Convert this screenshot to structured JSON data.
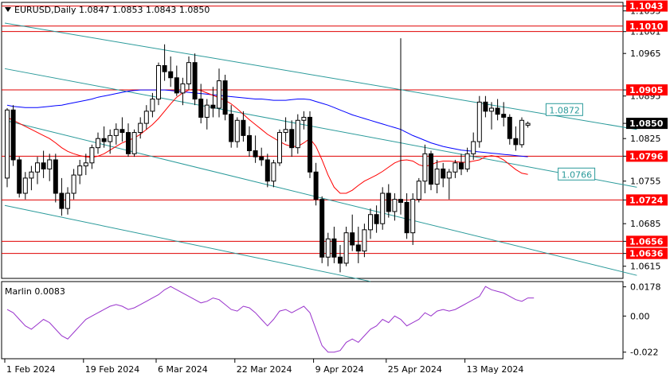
{
  "header": {
    "symbol_line": "EURUSD,Daily  1.0847 1.0853 1.0843 1.0850",
    "arrow_icon": "triangle-down-icon"
  },
  "chart_data": [
    {
      "type": "candlestick",
      "symbol": "EURUSD",
      "timeframe": "Daily",
      "ohlc": {
        "open": 1.0847,
        "high": 1.0853,
        "low": 1.0843,
        "close": 1.085
      },
      "ylim": [
        1.0595,
        1.1049
      ],
      "y_ticks": [
        "1.1043",
        "1.1035",
        "1.1001",
        "1.0965",
        "1.0905",
        "1.0895",
        "1.0850",
        "1.0825",
        "1.0796",
        "1.0755",
        "1.0724",
        "1.0685",
        "1.0656",
        "1.0636",
        "1.0615"
      ],
      "x_labels": [
        "1 Feb 2024",
        "19 Feb 2024",
        "6 Mar 2024",
        "22 Mar 2024",
        "9 Apr 2024",
        "25 Apr 2024",
        "13 May 2024"
      ],
      "price_labels": [
        {
          "text": "1.1043",
          "price": 1.1043,
          "color": "#ff0000"
        },
        {
          "text": "1.1010",
          "price": 1.101,
          "color": "#ff0000"
        },
        {
          "text": "1.0905",
          "price": 1.0905,
          "color": "#ff0000"
        },
        {
          "text": "1.0850",
          "price": 1.085,
          "color": "#000000"
        },
        {
          "text": "1.0796",
          "price": 1.0796,
          "color": "#ff0000"
        },
        {
          "text": "1.0724",
          "price": 1.0724,
          "color": "#ff0000"
        },
        {
          "text": "1.0656",
          "price": 1.0656,
          "color": "#ff0000"
        },
        {
          "text": "1.0636",
          "price": 1.0636,
          "color": "#ff0000"
        }
      ],
      "horizontal_levels": [
        1.1043,
        1.101,
        1.1001,
        1.0905,
        1.0796,
        1.0724,
        1.0656,
        1.0636
      ],
      "channel_labels": [
        {
          "text": "1.0872",
          "price": 1.0872
        },
        {
          "text": "1.0766",
          "price": 1.0766
        }
      ],
      "candles": [
        [
          1.076,
          1.0875,
          1.0745,
          1.0872
        ],
        [
          1.0872,
          1.088,
          1.078,
          1.079
        ],
        [
          1.079,
          1.0795,
          1.0728,
          1.0735
        ],
        [
          1.0735,
          1.077,
          1.0725,
          1.076
        ],
        [
          1.076,
          1.078,
          1.074,
          1.077
        ],
        [
          1.077,
          1.0795,
          1.075,
          1.0785
        ],
        [
          1.0785,
          1.0805,
          1.076,
          1.0775
        ],
        [
          1.0775,
          1.08,
          1.0755,
          1.079
        ],
        [
          1.079,
          1.08,
          1.072,
          1.0735
        ],
        [
          1.0735,
          1.076,
          1.0698,
          1.071
        ],
        [
          1.071,
          1.0745,
          1.07,
          1.0735
        ],
        [
          1.0735,
          1.0775,
          1.0725,
          1.0765
        ],
        [
          1.0765,
          1.079,
          1.075,
          1.078
        ],
        [
          1.078,
          1.08,
          1.0765,
          1.0785
        ],
        [
          1.0785,
          1.0815,
          1.0775,
          1.081
        ],
        [
          1.081,
          1.0835,
          1.08,
          1.0825
        ],
        [
          1.0825,
          1.0845,
          1.081,
          1.082
        ],
        [
          1.082,
          1.084,
          1.08,
          1.083
        ],
        [
          1.083,
          1.085,
          1.0815,
          1.084
        ],
        [
          1.084,
          1.086,
          1.082,
          1.0835
        ],
        [
          1.0835,
          1.085,
          1.0795,
          1.08
        ],
        [
          1.08,
          1.084,
          1.0795,
          1.0835
        ],
        [
          1.0835,
          1.086,
          1.0825,
          1.085
        ],
        [
          1.085,
          1.088,
          1.084,
          1.087
        ],
        [
          1.087,
          1.09,
          1.086,
          1.089
        ],
        [
          1.089,
          1.095,
          1.088,
          1.0945
        ],
        [
          1.0945,
          1.098,
          1.092,
          1.0935
        ],
        [
          1.0935,
          1.096,
          1.091,
          1.0925
        ],
        [
          1.0925,
          1.0945,
          1.0895,
          1.09
        ],
        [
          1.09,
          1.0925,
          1.088,
          1.0915
        ],
        [
          1.0915,
          1.096,
          1.0905,
          1.095
        ],
        [
          1.095,
          1.0965,
          1.088,
          1.089
        ],
        [
          1.089,
          1.0915,
          1.085,
          1.086
        ],
        [
          1.086,
          1.089,
          1.084,
          1.088
        ],
        [
          1.088,
          1.091,
          1.086,
          1.0875
        ],
        [
          1.0875,
          1.094,
          1.086,
          1.092
        ],
        [
          1.092,
          1.093,
          1.0855,
          1.0865
        ],
        [
          1.0865,
          1.088,
          1.081,
          1.082
        ],
        [
          1.082,
          1.086,
          1.081,
          1.0855
        ],
        [
          1.0855,
          1.087,
          1.082,
          1.083
        ],
        [
          1.083,
          1.0845,
          1.0795,
          1.0805
        ],
        [
          1.0805,
          1.083,
          1.0785,
          1.0795
        ],
        [
          1.0795,
          1.081,
          1.078,
          1.079
        ],
        [
          1.079,
          1.08,
          1.0745,
          1.0755
        ],
        [
          1.0755,
          1.079,
          1.0745,
          1.0785
        ],
        [
          1.0785,
          1.084,
          1.078,
          1.0835
        ],
        [
          1.0835,
          1.086,
          1.082,
          1.084
        ],
        [
          1.084,
          1.0855,
          1.0795,
          1.081
        ],
        [
          1.081,
          1.0865,
          1.08,
          1.0855
        ],
        [
          1.0855,
          1.087,
          1.084,
          1.086
        ],
        [
          1.086,
          1.087,
          1.076,
          1.077
        ],
        [
          1.077,
          1.0785,
          1.0715,
          1.0725
        ],
        [
          1.0725,
          1.073,
          1.062,
          1.063
        ],
        [
          1.063,
          1.067,
          1.0615,
          1.066
        ],
        [
          1.066,
          1.068,
          1.062,
          1.063
        ],
        [
          1.063,
          1.065,
          1.0605,
          1.062
        ],
        [
          1.062,
          1.068,
          1.0615,
          1.067
        ],
        [
          1.067,
          1.07,
          1.064,
          1.065
        ],
        [
          1.065,
          1.068,
          1.062,
          1.064
        ],
        [
          1.064,
          1.0685,
          1.063,
          1.0675
        ],
        [
          1.0675,
          1.071,
          1.066,
          1.07
        ],
        [
          1.07,
          1.0715,
          1.067,
          1.0685
        ],
        [
          1.0685,
          1.0745,
          1.0675,
          1.0735
        ],
        [
          1.0735,
          1.075,
          1.0695,
          1.0705
        ],
        [
          1.0705,
          1.0735,
          1.069,
          1.0725
        ],
        [
          1.0725,
          1.099,
          1.07,
          1.072
        ],
        [
          1.072,
          1.0735,
          1.066,
          1.067
        ],
        [
          1.067,
          1.0735,
          1.065,
          1.0725
        ],
        [
          1.0725,
          1.076,
          1.072,
          1.0755
        ],
        [
          1.0755,
          1.0815,
          1.0735,
          1.08
        ],
        [
          1.08,
          1.0805,
          1.074,
          1.075
        ],
        [
          1.075,
          1.079,
          1.0735,
          1.0775
        ],
        [
          1.0775,
          1.0785,
          1.0745,
          1.076
        ],
        [
          1.076,
          1.0775,
          1.0725,
          1.077
        ],
        [
          1.077,
          1.079,
          1.076,
          1.0785
        ],
        [
          1.0785,
          1.08,
          1.0765,
          1.0775
        ],
        [
          1.0775,
          1.081,
          1.077,
          1.08
        ],
        [
          1.08,
          1.0835,
          1.079,
          1.082
        ],
        [
          1.082,
          1.0895,
          1.081,
          1.0885
        ],
        [
          1.0885,
          1.0895,
          1.086,
          1.087
        ],
        [
          1.087,
          1.0885,
          1.084,
          1.0875
        ],
        [
          1.0875,
          1.089,
          1.0855,
          1.0865
        ],
        [
          1.0865,
          1.0885,
          1.0845,
          1.086
        ],
        [
          1.086,
          1.0865,
          1.0815,
          1.0825
        ],
        [
          1.0825,
          1.0845,
          1.0805,
          1.0815
        ],
        [
          1.0815,
          1.086,
          1.081,
          1.0855
        ],
        [
          1.0847,
          1.0853,
          1.0843,
          1.085
        ]
      ],
      "series": [
        {
          "name": "",
          "color": "#0000ff",
          "kind": "moving-average",
          "values": [
            1.088,
            1.0878,
            1.0877,
            1.0876,
            1.0876,
            1.0876,
            1.0877,
            1.0878,
            1.0879,
            1.088,
            1.0882,
            1.0884,
            1.0886,
            1.0888,
            1.089,
            1.0893,
            1.0895,
            1.0897,
            1.0899,
            1.0901,
            1.0903,
            1.0904,
            1.0905,
            1.0905,
            1.0905,
            1.0905,
            1.0905,
            1.0904,
            1.0903,
            1.0902,
            1.0901,
            1.09,
            1.0899,
            1.0898,
            1.0897,
            1.0896,
            1.0895,
            1.0894,
            1.0893,
            1.0892,
            1.0891,
            1.089,
            1.089,
            1.0889,
            1.0888,
            1.0888,
            1.0888,
            1.0889,
            1.089,
            1.089,
            1.0889,
            1.0886,
            1.0883,
            1.088,
            1.0876,
            1.0872,
            1.0868,
            1.0864,
            1.0861,
            1.0858,
            1.0855,
            1.0852,
            1.0849,
            1.0846,
            1.0843,
            1.084,
            1.0835,
            1.083,
            1.0826,
            1.0822,
            1.0818,
            1.0815,
            1.0812,
            1.081,
            1.0808,
            1.0806,
            1.0805,
            1.0804,
            1.0803,
            1.0802,
            1.0801,
            1.08,
            1.0799,
            1.0798,
            1.0797,
            1.0796,
            1.0795
          ]
        },
        {
          "name": "",
          "color": "#ff0000",
          "kind": "moving-average",
          "values": [
            1.086,
            1.0855,
            1.085,
            1.0845,
            1.084,
            1.0835,
            1.083,
            1.0825,
            1.0818,
            1.081,
            1.0804,
            1.08,
            1.0797,
            1.0795,
            1.0794,
            1.0796,
            1.08,
            1.0806,
            1.0812,
            1.0818,
            1.0822,
            1.0826,
            1.0832,
            1.084,
            1.0848,
            1.0858,
            1.087,
            1.0882,
            1.0893,
            1.09,
            1.0905,
            1.0906,
            1.0904,
            1.09,
            1.0896,
            1.0892,
            1.0888,
            1.0882,
            1.0874,
            1.0865,
            1.0856,
            1.0848,
            1.084,
            1.0832,
            1.0826,
            1.082,
            1.0815,
            1.0812,
            1.0812,
            1.0818,
            1.0825,
            1.0812,
            1.079,
            1.0765,
            1.0745,
            1.0735,
            1.0735,
            1.074,
            1.0748,
            1.0755,
            1.076,
            1.0765,
            1.0771,
            1.0778,
            1.0785,
            1.0789,
            1.079,
            1.0788,
            1.0782,
            1.0779,
            1.0782,
            1.0786,
            1.0788,
            1.0788,
            1.0787,
            1.0786,
            1.0786,
            1.0788,
            1.079,
            1.0795,
            1.0797,
            1.0795,
            1.079,
            1.0782,
            1.0774,
            1.0768,
            1.0766
          ]
        }
      ]
    },
    {
      "type": "line",
      "title": "Marlin 0.0083",
      "ylim": [
        -0.026,
        0.021
      ],
      "y_ticks": [
        "0.0178",
        "0.00",
        "-0.022"
      ],
      "series": [
        {
          "name": "Marlin",
          "color": "#9933cc",
          "values": [
            0.004,
            0.002,
            -0.002,
            -0.006,
            -0.008,
            -0.005,
            -0.002,
            -0.004,
            -0.008,
            -0.012,
            -0.014,
            -0.01,
            -0.006,
            -0.002,
            0.0,
            0.002,
            0.004,
            0.006,
            0.007,
            0.006,
            0.004,
            0.005,
            0.007,
            0.009,
            0.011,
            0.013,
            0.016,
            0.018,
            0.016,
            0.014,
            0.012,
            0.01,
            0.008,
            0.009,
            0.011,
            0.01,
            0.007,
            0.004,
            0.003,
            0.006,
            0.005,
            0.002,
            -0.002,
            -0.006,
            -0.002,
            0.003,
            0.004,
            0.002,
            0.004,
            0.006,
            0.002,
            -0.008,
            -0.018,
            -0.022,
            -0.022,
            -0.021,
            -0.016,
            -0.014,
            -0.016,
            -0.012,
            -0.008,
            -0.006,
            -0.002,
            -0.004,
            0.0,
            -0.002,
            -0.006,
            -0.004,
            -0.002,
            0.002,
            0.0,
            0.003,
            0.004,
            0.003,
            0.004,
            0.006,
            0.008,
            0.01,
            0.012,
            0.018,
            0.016,
            0.015,
            0.014,
            0.012,
            0.01,
            0.009,
            0.011,
            0.011
          ]
        }
      ]
    }
  ]
}
